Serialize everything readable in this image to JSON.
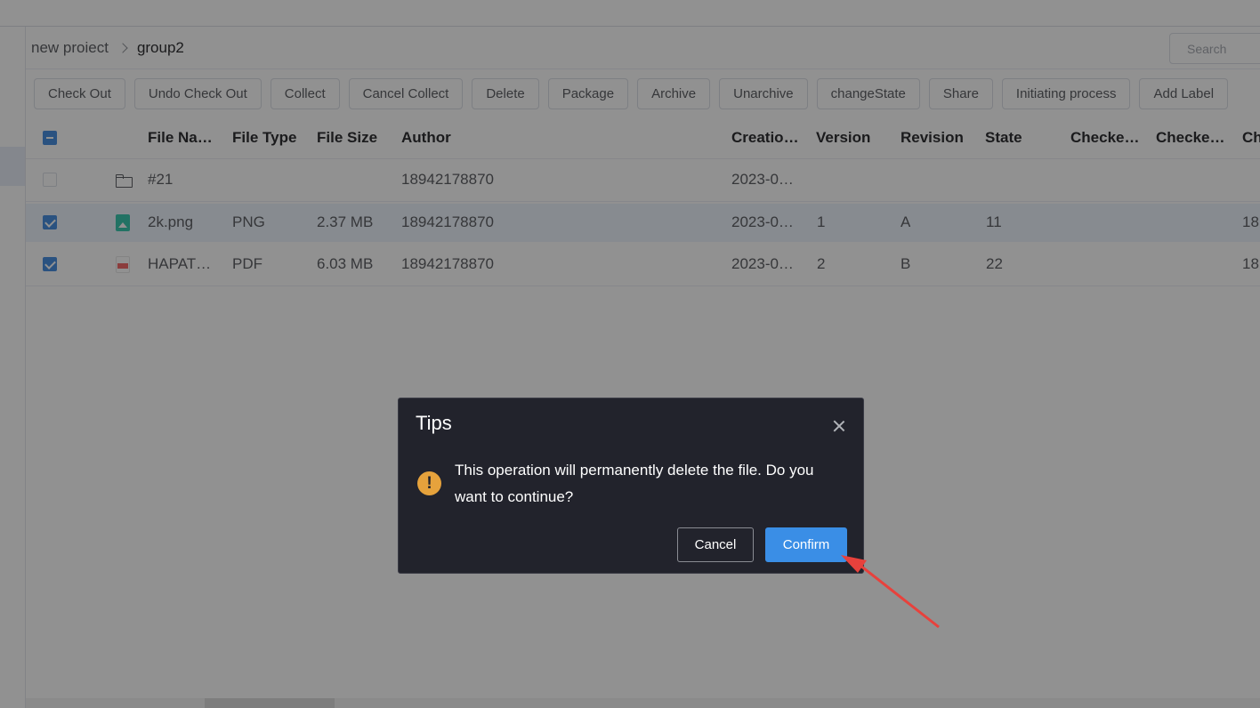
{
  "breadcrumb": {
    "project": "new proiect",
    "current": "group2"
  },
  "search": {
    "placeholder": "Search",
    "value": ""
  },
  "toolbar": {
    "buttons": [
      "Check Out",
      "Undo Check Out",
      "Collect",
      "Cancel Collect",
      "Delete",
      "Package",
      "Archive",
      "Unarchive",
      "changeState",
      "Share",
      "Initiating process",
      "Add Label"
    ]
  },
  "table": {
    "columns": [
      "File Na…",
      "File Type",
      "File Size",
      "Author",
      "Creatio…",
      "Version",
      "Revision",
      "State",
      "Checke…",
      "Checke…",
      "Ch"
    ],
    "rows": [
      {
        "selected": false,
        "icon": "folder-icon",
        "name": "#21",
        "type": "",
        "size": "",
        "author": "18942178870",
        "created": "2023-0…",
        "version": "",
        "revision": "",
        "state": "",
        "col11": ""
      },
      {
        "selected": true,
        "icon": "image-file-icon",
        "name": "2k.png",
        "type": "PNG",
        "size": "2.37 MB",
        "author": "18942178870",
        "created": "2023-0…",
        "version": "1",
        "revision": "A",
        "state": "11",
        "col11": "18"
      },
      {
        "selected": true,
        "icon": "pdf-file-icon",
        "name": "HAPAT…",
        "type": "PDF",
        "size": "6.03 MB",
        "author": "18942178870",
        "created": "2023-0…",
        "version": "2",
        "revision": "B",
        "state": "22",
        "col11": "18"
      }
    ]
  },
  "dialog": {
    "title": "Tips",
    "message": "This operation will permanently delete the file. Do you want to continue?",
    "cancel_label": "Cancel",
    "confirm_label": "Confirm",
    "icon": "warning-icon"
  },
  "colors": {
    "accent": "#3a8ee6",
    "warning": "#e6a23c",
    "dialog_bg": "#22232c",
    "annotation_arrow": "#e8413c"
  }
}
